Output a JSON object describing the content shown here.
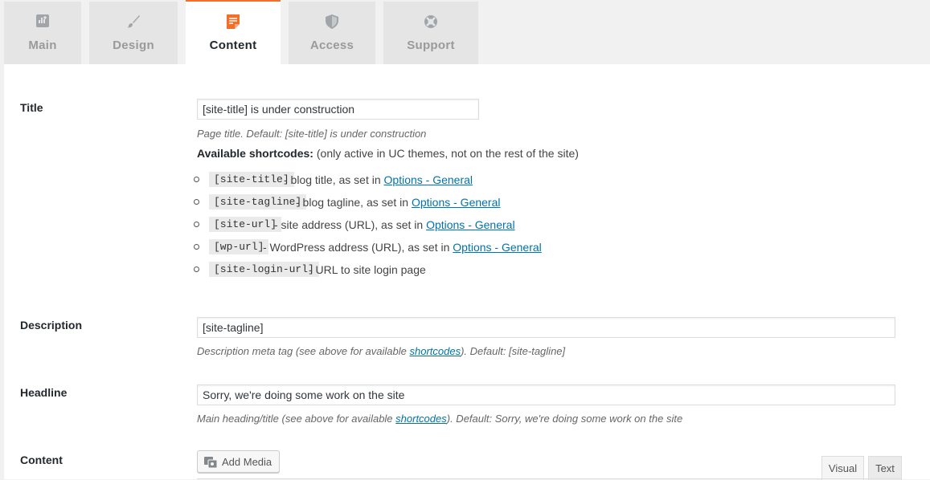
{
  "tabs": [
    {
      "label": "Main",
      "icon": "dashboard-icon",
      "active": false
    },
    {
      "label": "Design",
      "icon": "paintbrush-icon",
      "active": false
    },
    {
      "label": "Content",
      "icon": "document-icon",
      "active": true
    },
    {
      "label": "Access",
      "icon": "shield-icon",
      "active": false
    },
    {
      "label": "Support",
      "icon": "lifebuoy-icon",
      "active": false
    }
  ],
  "accent_color": "#f56e28",
  "link_color": "#0073aa",
  "title_section": {
    "label": "Title",
    "value": "[site-title] is under construction",
    "description": "Page title. Default: [site-title] is under construction",
    "available_bold": "Available shortcodes:",
    "available_rest": " (only active in UC themes, not on the rest of the site)",
    "shortcodes": [
      {
        "code": "[site-title]",
        "text": " - blog title, as set in ",
        "link": "Options - General"
      },
      {
        "code": "[site-tagline]",
        "text": " - blog tagline, as set in ",
        "link": "Options - General"
      },
      {
        "code": "[site-url]",
        "text": " - site address (URL), as set in ",
        "link": "Options - General"
      },
      {
        "code": "[wp-url]",
        "text": " - WordPress address (URL), as set in ",
        "link": "Options - General"
      },
      {
        "code": "[site-login-url]",
        "text": " - URL to site login page",
        "link": ""
      }
    ]
  },
  "description_section": {
    "label": "Description",
    "value": "[site-tagline]",
    "desc_before": "Description meta tag (see above for available ",
    "desc_link": "shortcodes",
    "desc_after": "). Default: [site-tagline]"
  },
  "headline_section": {
    "label": "Headline",
    "value": "Sorry, we're doing some work on the site",
    "desc_before": "Main heading/title (see above for available ",
    "desc_link": "shortcodes",
    "desc_after": "). Default: Sorry, we're doing some work on the site"
  },
  "content_section": {
    "label": "Content",
    "add_media": "Add Media",
    "visual_tab": "Visual",
    "text_tab": "Text"
  }
}
